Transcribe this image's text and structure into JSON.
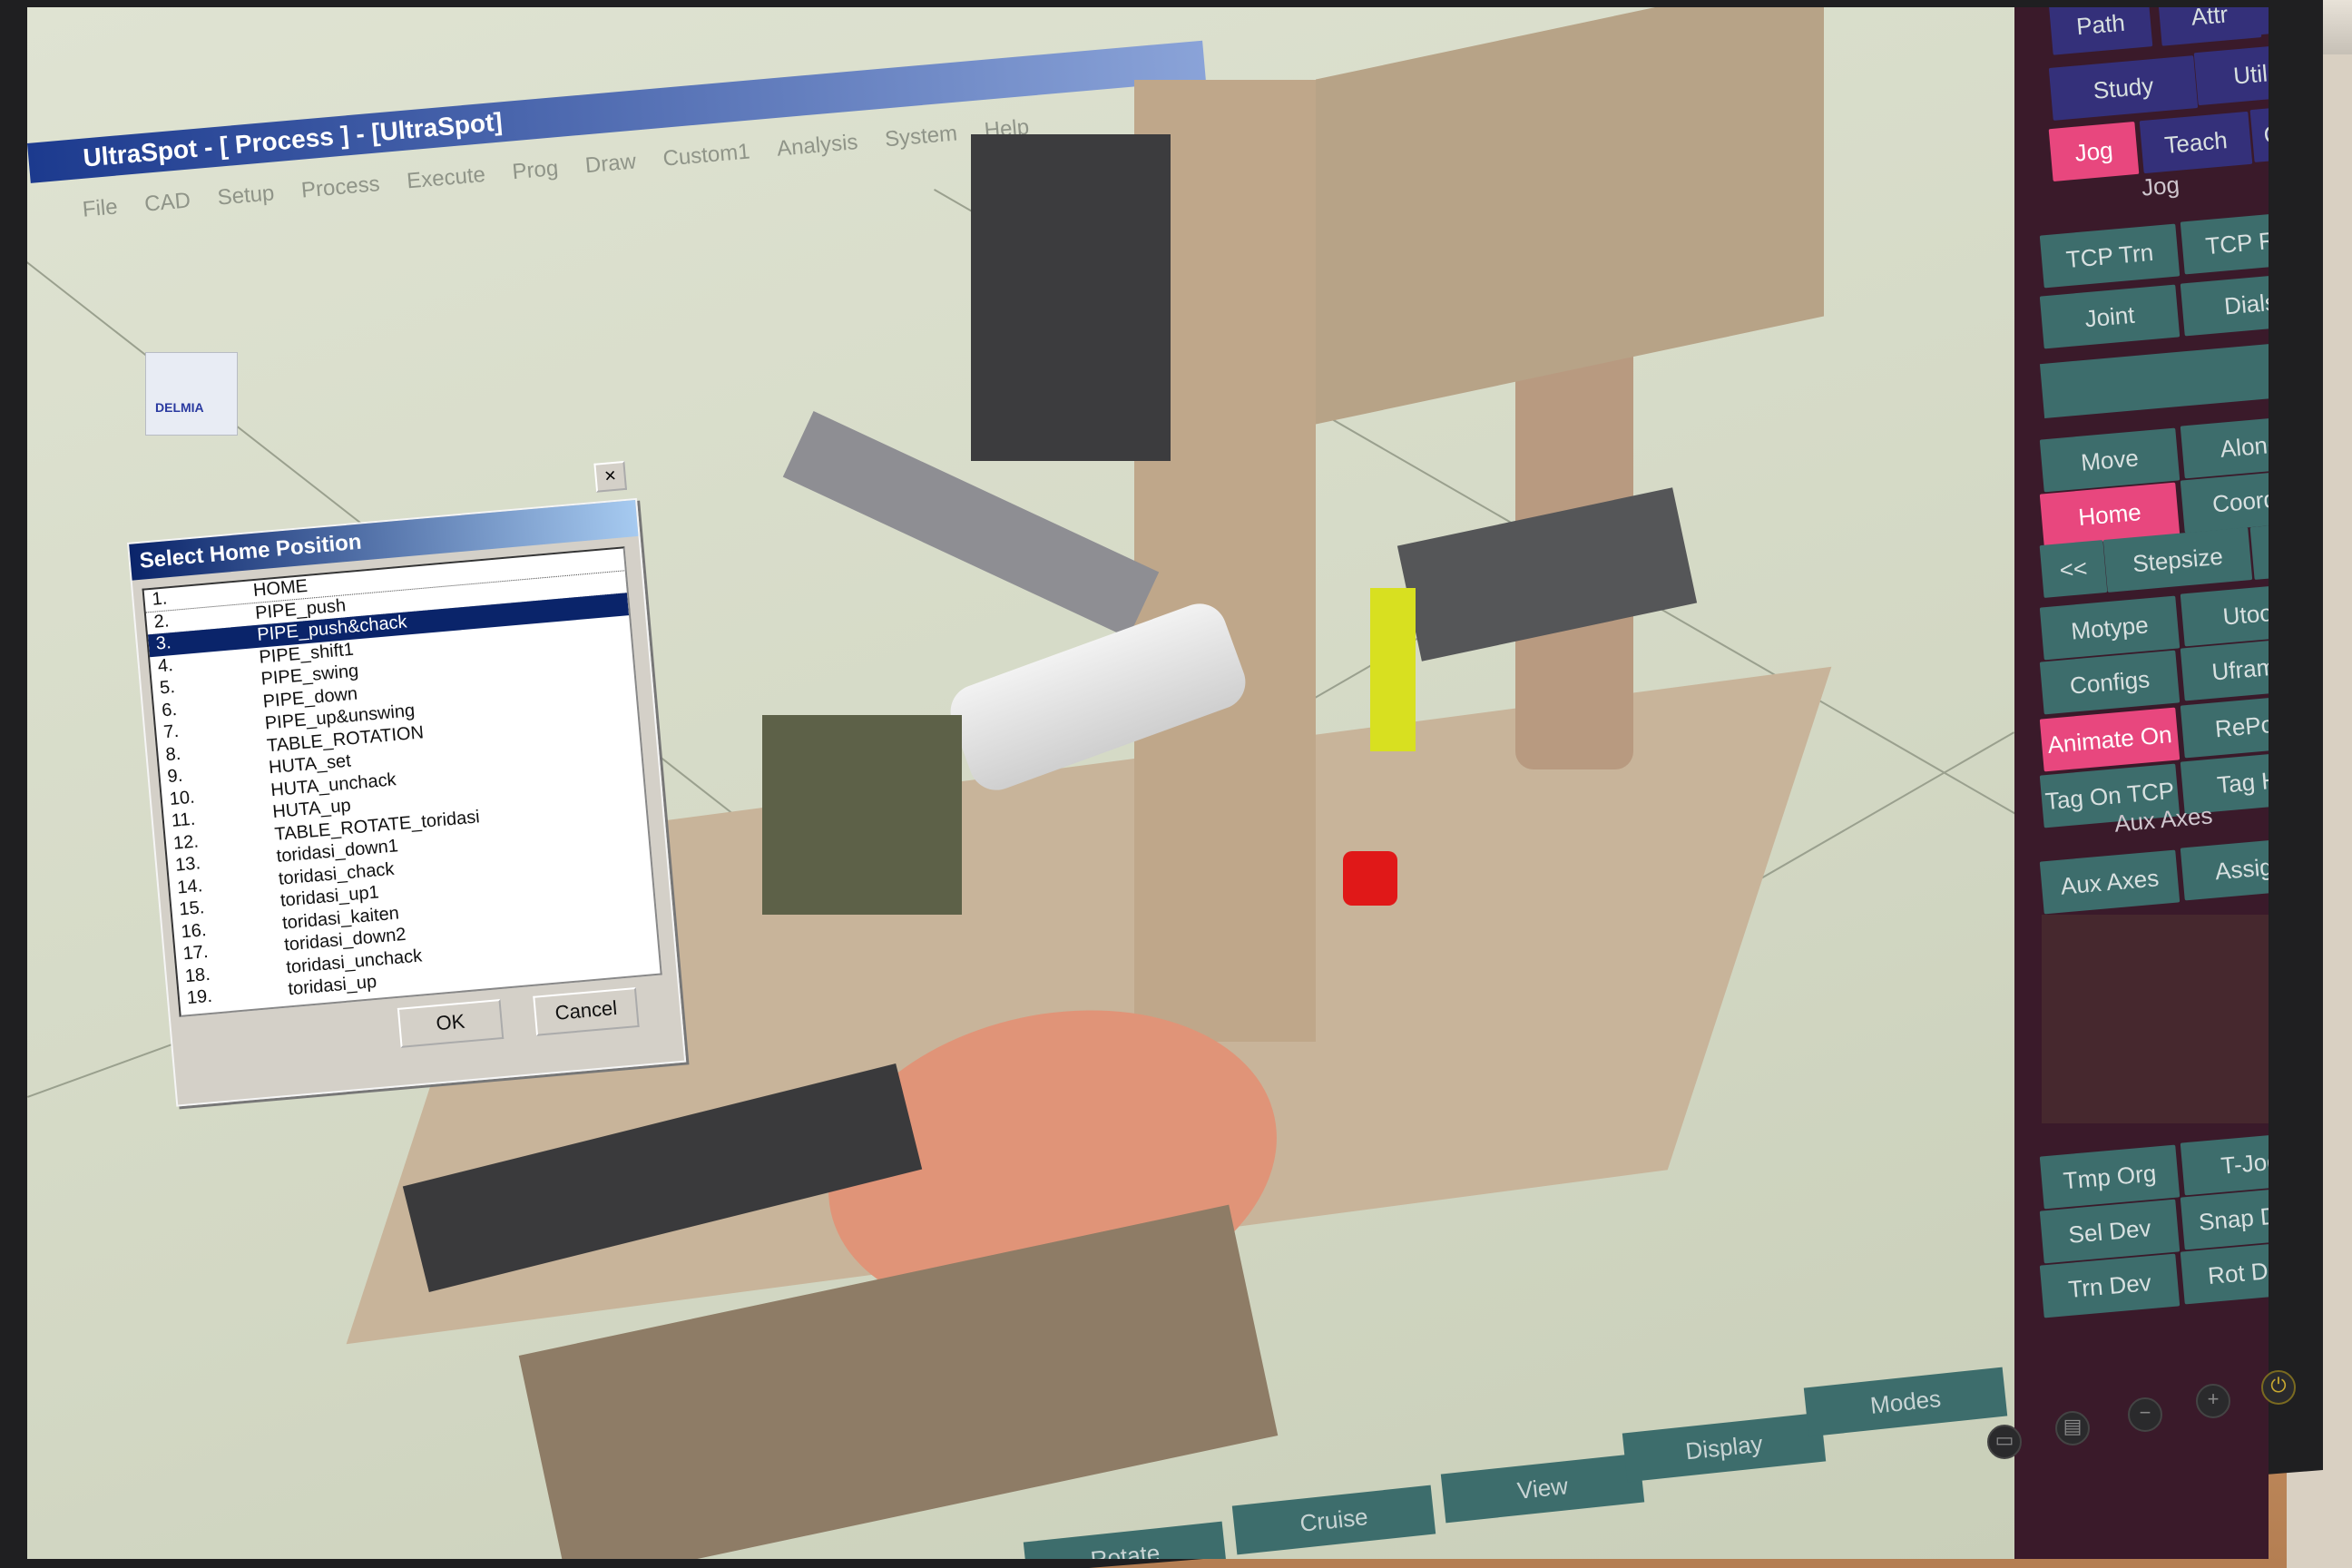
{
  "window": {
    "title": "UltraSpot - [ Process ] - [UltraSpot]",
    "logo_text": "DELMIA"
  },
  "menu": [
    "File",
    "CAD",
    "Setup",
    "Process",
    "Execute",
    "Prog",
    "Draw",
    "Custom1",
    "Analysis",
    "System",
    "Help"
  ],
  "dialog": {
    "title": "Select Home Position",
    "close": "×",
    "items": [
      {
        "num": "1.",
        "label": "HOME"
      },
      {
        "num": "2.",
        "label": "PIPE_push"
      },
      {
        "num": "3.",
        "label": "PIPE_push&chack"
      },
      {
        "num": "4.",
        "label": "PIPE_shift1"
      },
      {
        "num": "5.",
        "label": "PIPE_swing"
      },
      {
        "num": "6.",
        "label": "PIPE_down"
      },
      {
        "num": "7.",
        "label": "PIPE_up&unswing"
      },
      {
        "num": "8.",
        "label": "TABLE_ROTATION"
      },
      {
        "num": "9.",
        "label": "HUTA_set"
      },
      {
        "num": "10.",
        "label": "HUTA_unchack"
      },
      {
        "num": "11.",
        "label": "HUTA_up"
      },
      {
        "num": "12.",
        "label": "TABLE_ROTATE_toridasi"
      },
      {
        "num": "13.",
        "label": "toridasi_down1"
      },
      {
        "num": "14.",
        "label": "toridasi_chack"
      },
      {
        "num": "15.",
        "label": "toridasi_up1"
      },
      {
        "num": "16.",
        "label": "toridasi_kaiten"
      },
      {
        "num": "17.",
        "label": "toridasi_down2"
      },
      {
        "num": "18.",
        "label": "toridasi_unchack"
      },
      {
        "num": "19.",
        "label": "toridasi_up"
      }
    ],
    "selected_index": 2,
    "ok_label": "OK",
    "cancel_label": "Cancel"
  },
  "panel": {
    "top_row": [
      "Path",
      "Attr",
      "At"
    ],
    "row2": [
      "Study",
      "Util"
    ],
    "row3": [
      "Jog",
      "Teach",
      "Coll"
    ],
    "jog_header": "Jog",
    "jog_buttons": [
      "TCP Trn",
      "TCP Rot",
      "Joint",
      "Dials"
    ],
    "move_buttons": [
      "Move",
      "Along",
      "Home",
      "Coords",
      "<<",
      "Stepsize",
      ">>",
      "Motype",
      "Utool",
      "Configs",
      "Uframe",
      "Animate On",
      "RePos",
      "Tag On TCP",
      "Tag Hi"
    ],
    "aux_header": "Aux Axes",
    "aux_buttons": [
      "Aux Axes",
      "Assign"
    ],
    "bottom_buttons": [
      "Tmp Org",
      "T-Jog",
      "Sel Dev",
      "Snap Dev",
      "Trn Dev",
      "Rot Dev"
    ]
  },
  "bottom_tabs": [
    "Rotate",
    "Cruise",
    "View",
    "Display",
    "Modes"
  ],
  "colors": {
    "accent_pink": "#e8477e",
    "navy_button": "#34307a",
    "teal_button": "#3d6d6c",
    "titlebar": "#0a246a"
  }
}
